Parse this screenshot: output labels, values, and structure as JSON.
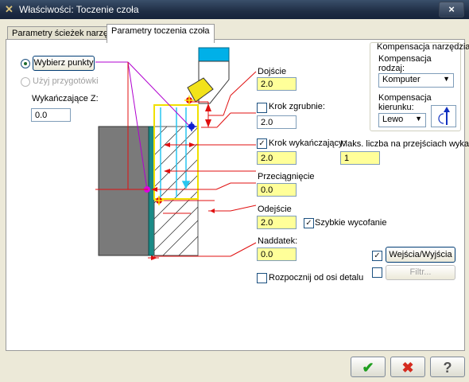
{
  "window": {
    "title": "Właściwości: Toczenie czoła",
    "close_label": "×"
  },
  "tabs": [
    {
      "label": "Parametry ścieżek narzędzia",
      "active": false
    },
    {
      "label": "Parametry toczenia czoła",
      "active": true
    }
  ],
  "left": {
    "select_points_label": "Wybierz punkty",
    "use_stock_label": "Użyj przygotówki",
    "finish_z_label": "Wykańczające Z:",
    "finish_z_value": "0.0"
  },
  "fields": {
    "approach_label": "Dojście",
    "approach_value": "2.0",
    "rough_step_label": "Krok zgrubnie:",
    "rough_step_value": "2.0",
    "finish_step_label": "Krok wykańczający:",
    "finish_step_value": "2.0",
    "max_finish_passes_label": "Maks. liczba na przejściach wykań.:",
    "max_finish_passes_value": "1",
    "overcut_label": "Przeciągnięcie",
    "overcut_value": "0.0",
    "retract_label": "Odejście",
    "retract_value": "2.0",
    "rapid_retract_label": "Szybkie wycofanie",
    "stock_allowance_label": "Naddatek:",
    "stock_allowance_value": "0.0",
    "start_from_axis_label": "Rozpocznij od osi detalu"
  },
  "compensation": {
    "group_title": "Kompensacja narzędzia",
    "type_label": "Kompensacja rodzaj:",
    "type_value": "Komputer",
    "direction_label": "Kompensacja kierunku:",
    "direction_value": "Lewo"
  },
  "buttons": {
    "entry_exit_label": "Wejścia/Wyjścia",
    "filter_label": "Filtr..."
  },
  "bottom": {
    "ok_label": "✔",
    "cancel_label": "✖",
    "help_label": "?"
  },
  "colors": {
    "field_bg": "#ffff99",
    "ok_green": "#1f9e1f",
    "cancel_red": "#d42b1e",
    "dim_red": "#e01010"
  }
}
